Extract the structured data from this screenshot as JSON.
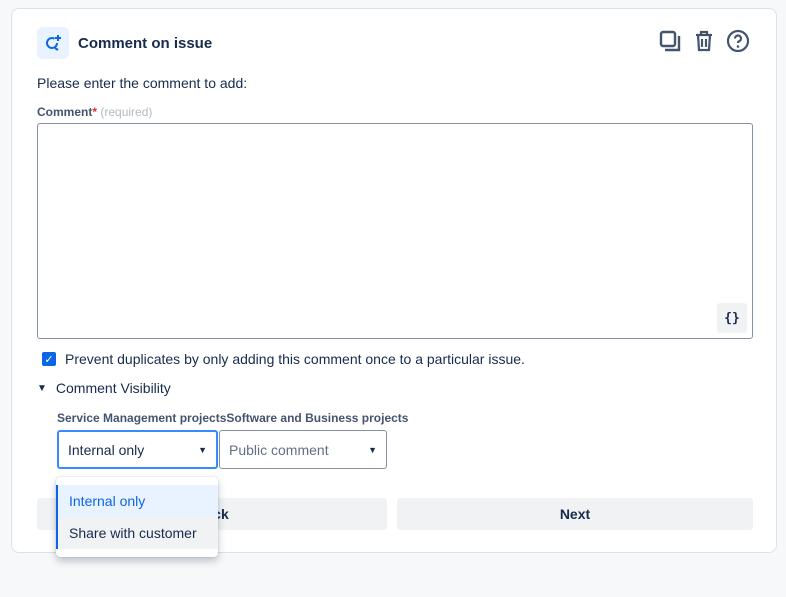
{
  "header": {
    "title": "Comment on issue",
    "icons": [
      "comment-add-icon",
      "copy-icon",
      "trash-icon",
      "help-icon"
    ]
  },
  "intro": "Please enter the comment to add:",
  "comment": {
    "label": "Comment",
    "required_mark": "*",
    "required_hint": "(required)",
    "value": "",
    "insert_label": "{}"
  },
  "prevent_duplicates": {
    "checked": true,
    "label": "Prevent duplicates by only adding this comment once to a particular issue."
  },
  "visibility": {
    "label": "Comment Visibility",
    "sm_label": "Service Management projects",
    "sb_label": "Software and Business projects",
    "sm_value": "Internal only",
    "sb_value": "Public comment",
    "options": [
      "Internal only",
      "Share with customer"
    ]
  },
  "buttons": {
    "back": "Back",
    "next": "Next"
  },
  "colors": {
    "accent": "#0c66e4"
  }
}
